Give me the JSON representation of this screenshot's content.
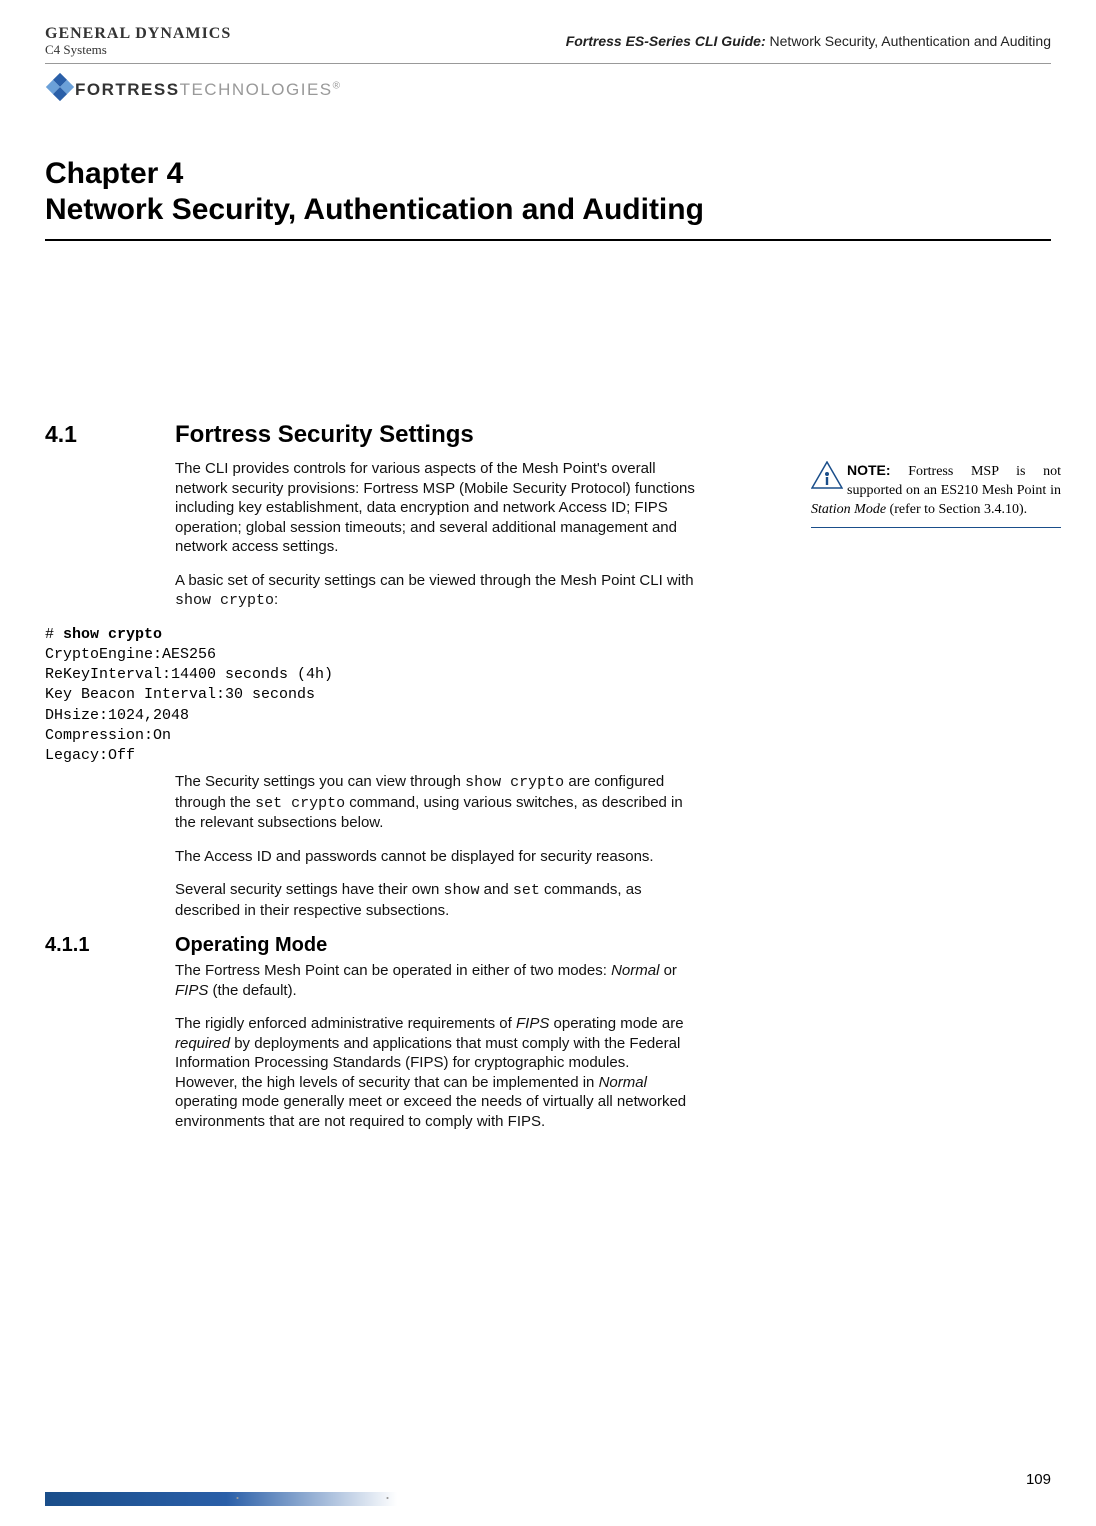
{
  "header": {
    "logo_gd_line1": "GENERAL DYNAMICS",
    "logo_gd_line2": "C4 Systems",
    "guide_title_italic": "Fortress ES-Series CLI Guide:",
    "guide_title_rest": " Network Security, Authentication and Auditing",
    "fortress_bold": "FORTRESS",
    "fortress_thin": "TECHNOLOGIES",
    "fortress_reg": "®"
  },
  "chapter": {
    "number": "Chapter 4",
    "title": "Network Security, Authentication and Auditing"
  },
  "section41": {
    "num": "4.1",
    "title": "Fortress Security Settings",
    "para1": "The CLI provides controls for various aspects of the Mesh Point's overall network security provisions: Fortress MSP (Mobile Security Protocol) functions including key establishment, data encryption and network Access ID; FIPS operation; global session timeouts; and several additional management and network access settings.",
    "para2a": "A basic set of security settings can be viewed through the Mesh Point CLI with ",
    "para2b": "show crypto",
    "para2c": ":",
    "code_prompt": "# ",
    "code_cmd": "show crypto",
    "code_l1": "CryptoEngine:AES256",
    "code_l2": "ReKeyInterval:14400 seconds (4h)",
    "code_l3": "Key Beacon Interval:30 seconds",
    "code_l4": "DHsize:1024,2048",
    "code_l5": "Compression:On",
    "code_l6": "Legacy:Off",
    "para3a": "The Security settings you can view through ",
    "para3b": "show crypto",
    "para3c": " are configured through the ",
    "para3d": "set crypto",
    "para3e": " command, using various switches, as described in the relevant subsections below.",
    "para4": "The Access ID and passwords cannot be displayed for security reasons.",
    "para5a": "Several security settings have their own ",
    "para5b": "show",
    "para5c": " and ",
    "para5d": "set",
    "para5e": " commands, as described in their respective subsections."
  },
  "note": {
    "label": "NOTE:",
    "text_a": " Fortress MSP is not supported on an ES210 Mesh Point in ",
    "text_b": "Station Mode",
    "text_c": " (refer to Section 3.4.10)."
  },
  "section411": {
    "num": "4.1.1",
    "title": "Operating Mode",
    "para1a": "The Fortress Mesh Point can be operated in either of two modes: ",
    "para1b": "Normal",
    "para1c": " or ",
    "para1d": "FIPS",
    "para1e": " (the default).",
    "para2a": "The rigidly enforced administrative requirements of ",
    "para2b": "FIPS",
    "para2c": " operating mode are ",
    "para2d": "required",
    "para2e": " by deployments and applications that must comply with the Federal Information Processing Standards (FIPS) for cryptographic modules. However, the high levels of security that can be implemented in ",
    "para2f": "Normal",
    "para2g": " operating mode generally meet or exceed the needs of virtually all networked environments that are not required to comply with FIPS."
  },
  "footer": {
    "page": "109"
  }
}
